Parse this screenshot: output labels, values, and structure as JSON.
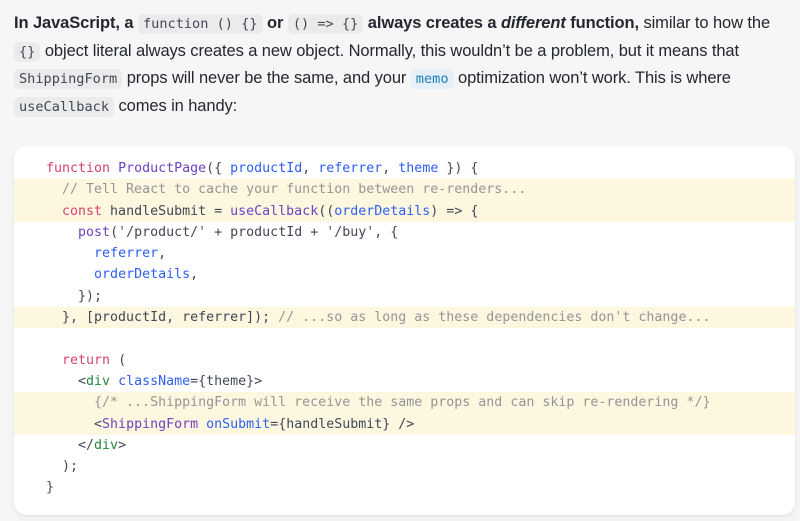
{
  "paragraph": {
    "segments": [
      {
        "text": "In JavaScript, a ",
        "style": "bold"
      },
      {
        "text": "function () {}",
        "style": "code"
      },
      {
        "text": " or ",
        "style": "bold"
      },
      {
        "text": "() => {}",
        "style": "code"
      },
      {
        "text": " always creates a ",
        "style": "bold"
      },
      {
        "text": "different",
        "style": "bold-italic"
      },
      {
        "text": " function,",
        "style": "bold"
      },
      {
        "text": " similar to how the ",
        "style": "normal"
      },
      {
        "text": "{}",
        "style": "code"
      },
      {
        "text": " object literal always creates a new object. Normally, this wouldn’t be a problem, but it means that ",
        "style": "normal"
      },
      {
        "text": "ShippingForm",
        "style": "code"
      },
      {
        "text": " props will never be the same, and your ",
        "style": "normal"
      },
      {
        "text": "memo",
        "style": "code-link"
      },
      {
        "text": " optimization won’t work. This is where ",
        "style": "normal"
      },
      {
        "text": "useCallback",
        "style": "code"
      },
      {
        "text": " comes in handy:",
        "style": "normal"
      }
    ]
  },
  "code_block": {
    "language": "jsx",
    "lines": [
      {
        "highlighted": false,
        "tokens": [
          {
            "t": "function ",
            "c": "kw"
          },
          {
            "t": "ProductPage",
            "c": "fn"
          },
          {
            "t": "({ ",
            "c": "pl"
          },
          {
            "t": "productId",
            "c": "var"
          },
          {
            "t": ", ",
            "c": "pl"
          },
          {
            "t": "referrer",
            "c": "var"
          },
          {
            "t": ", ",
            "c": "pl"
          },
          {
            "t": "theme",
            "c": "var"
          },
          {
            "t": " }) {",
            "c": "pl"
          }
        ]
      },
      {
        "highlighted": true,
        "tokens": [
          {
            "t": "  // Tell React to cache your function between re-renders...",
            "c": "com"
          }
        ]
      },
      {
        "highlighted": true,
        "tokens": [
          {
            "t": "  ",
            "c": "pl"
          },
          {
            "t": "const",
            "c": "kw"
          },
          {
            "t": " handleSubmit = ",
            "c": "pl"
          },
          {
            "t": "useCallback",
            "c": "fn"
          },
          {
            "t": "((",
            "c": "pl"
          },
          {
            "t": "orderDetails",
            "c": "var"
          },
          {
            "t": ") => {",
            "c": "pl"
          }
        ]
      },
      {
        "highlighted": false,
        "tokens": [
          {
            "t": "    ",
            "c": "pl"
          },
          {
            "t": "post",
            "c": "fn"
          },
          {
            "t": "(",
            "c": "pl"
          },
          {
            "t": "'/product/'",
            "c": "str"
          },
          {
            "t": " + productId + ",
            "c": "pl"
          },
          {
            "t": "'/buy'",
            "c": "str"
          },
          {
            "t": ", {",
            "c": "pl"
          }
        ]
      },
      {
        "highlighted": false,
        "tokens": [
          {
            "t": "      ",
            "c": "pl"
          },
          {
            "t": "referrer",
            "c": "var"
          },
          {
            "t": ",",
            "c": "pl"
          }
        ]
      },
      {
        "highlighted": false,
        "tokens": [
          {
            "t": "      ",
            "c": "pl"
          },
          {
            "t": "orderDetails",
            "c": "var"
          },
          {
            "t": ",",
            "c": "pl"
          }
        ]
      },
      {
        "highlighted": false,
        "tokens": [
          {
            "t": "    });",
            "c": "pl"
          }
        ]
      },
      {
        "highlighted": true,
        "tokens": [
          {
            "t": "  }, [productId, referrer]); ",
            "c": "pl"
          },
          {
            "t": "// ...so as long as these dependencies don't change...",
            "c": "com"
          }
        ]
      },
      {
        "highlighted": false,
        "tokens": [
          {
            "t": "",
            "c": "pl"
          }
        ]
      },
      {
        "highlighted": false,
        "tokens": [
          {
            "t": "  ",
            "c": "pl"
          },
          {
            "t": "return",
            "c": "kw"
          },
          {
            "t": " (",
            "c": "pl"
          }
        ]
      },
      {
        "highlighted": false,
        "tokens": [
          {
            "t": "    <",
            "c": "pl"
          },
          {
            "t": "div",
            "c": "tag"
          },
          {
            "t": " ",
            "c": "pl"
          },
          {
            "t": "className",
            "c": "attr"
          },
          {
            "t": "={theme}>",
            "c": "pl"
          }
        ]
      },
      {
        "highlighted": true,
        "tokens": [
          {
            "t": "      {/* ...ShippingForm will receive the same props and can skip re-rendering */}",
            "c": "com"
          }
        ]
      },
      {
        "highlighted": true,
        "tokens": [
          {
            "t": "      <",
            "c": "pl"
          },
          {
            "t": "ShippingForm",
            "c": "comp"
          },
          {
            "t": " ",
            "c": "pl"
          },
          {
            "t": "onSubmit",
            "c": "attr"
          },
          {
            "t": "={handleSubmit} />",
            "c": "pl"
          }
        ]
      },
      {
        "highlighted": false,
        "tokens": [
          {
            "t": "    </",
            "c": "pl"
          },
          {
            "t": "div",
            "c": "tag"
          },
          {
            "t": ">",
            "c": "pl"
          }
        ]
      },
      {
        "highlighted": false,
        "tokens": [
          {
            "t": "  );",
            "c": "pl"
          }
        ]
      },
      {
        "highlighted": false,
        "tokens": [
          {
            "t": "}",
            "c": "pl"
          }
        ]
      }
    ]
  },
  "colors": {
    "page_background": "#f6f6f7",
    "code_background": "#ffffff",
    "highlight_background": "#fdf7e0",
    "text": "#23272f",
    "code_text": "#404756",
    "keyword": "#d6436f",
    "function": "#6f42c1",
    "variable": "#2d5ff2",
    "tag": "#22863a",
    "comment": "#949597",
    "link": "#1a80b3",
    "inline_code_background": "#ebebec",
    "inline_link_background": "#e6effa"
  }
}
